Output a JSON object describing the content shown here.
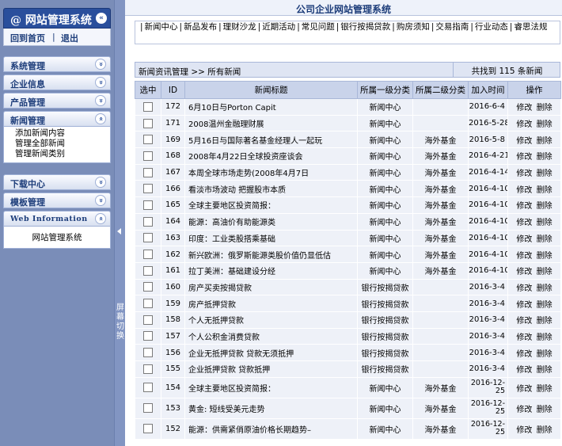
{
  "sidebar": {
    "title": "网站管理系统",
    "at_symbol": "@",
    "collapse_glyph": "«",
    "expand_glyph": "»",
    "links": {
      "home": "回到首页",
      "divider": "|",
      "logout": "退出"
    },
    "menus": [
      {
        "label": "系统管理"
      },
      {
        "label": "企业信息"
      },
      {
        "label": "产品管理"
      },
      {
        "label": "新闻管理",
        "items": [
          "添加新闻内容",
          "管理全部新闻",
          "管理新闻类别"
        ]
      },
      {
        "label": "下载中心"
      },
      {
        "label": "模板管理"
      },
      {
        "label": "Web Information",
        "items": [
          "网站管理系统"
        ]
      }
    ]
  },
  "splitter": {
    "label": "屏幕切换"
  },
  "main": {
    "title": "公司企业网站管理系统",
    "nav": [
      "新闻中心",
      "新品发布",
      "理财沙龙",
      "近期活动",
      "常见问题",
      "银行按揭贷款",
      "购房须知",
      "交易指南",
      "行业动态",
      "睿思法规"
    ],
    "nav_sep": "|",
    "breadcrumb": "新闻资讯管理 >> 所有新闻",
    "count_text": "共找到 115 条新闻",
    "table": {
      "headers": [
        "选中",
        "ID",
        "新闻标题",
        "所属一级分类",
        "所属二级分类",
        "加入时间",
        "操作"
      ],
      "edit_label": "修改",
      "delete_label": "删除",
      "rows": [
        {
          "id": "172",
          "title": "6月10日与Porton Capit",
          "cat1": "新闻中心",
          "cat2": "",
          "date": "2016-6-4"
        },
        {
          "id": "171",
          "title": "2008温州金融理财展",
          "cat1": "新闻中心",
          "cat2": "",
          "date": "2016-5-28"
        },
        {
          "id": "169",
          "title": "5月16日与国际著名基金经理人一起玩",
          "cat1": "新闻中心",
          "cat2": "海外基金",
          "date": "2016-5-8"
        },
        {
          "id": "168",
          "title": "2008年4月22日全球投资座谈会",
          "cat1": "新闻中心",
          "cat2": "海外基金",
          "date": "2016-4-21"
        },
        {
          "id": "167",
          "title": "本周全球市场走势(2008年4月7日",
          "cat1": "新闻中心",
          "cat2": "海外基金",
          "date": "2016-4-14"
        },
        {
          "id": "166",
          "title": "看淡市场波动 把握股市本质",
          "cat1": "新闻中心",
          "cat2": "海外基金",
          "date": "2016-4-10"
        },
        {
          "id": "165",
          "title": "全球主要地区投资简报：",
          "cat1": "新闻中心",
          "cat2": "海外基金",
          "date": "2016-4-10"
        },
        {
          "id": "164",
          "title": "能源：高油价有助能源类",
          "cat1": "新闻中心",
          "cat2": "海外基金",
          "date": "2016-4-10"
        },
        {
          "id": "163",
          "title": "印度：工业类股搭乘基础",
          "cat1": "新闻中心",
          "cat2": "海外基金",
          "date": "2016-4-10"
        },
        {
          "id": "162",
          "title": "新兴欧洲：俄罗斯能源类股价值仍显低估",
          "cat1": "新闻中心",
          "cat2": "海外基金",
          "date": "2016-4-10"
        },
        {
          "id": "161",
          "title": "拉丁美洲：基础建设分经",
          "cat1": "新闻中心",
          "cat2": "海外基金",
          "date": "2016-4-10"
        },
        {
          "id": "160",
          "title": "房产买卖按揭贷款",
          "cat1": "银行按揭贷款",
          "cat2": "",
          "date": "2016-3-4"
        },
        {
          "id": "159",
          "title": "房产抵押贷款",
          "cat1": "银行按揭贷款",
          "cat2": "",
          "date": "2016-3-4"
        },
        {
          "id": "158",
          "title": "个人无抵押贷款",
          "cat1": "银行按揭贷款",
          "cat2": "",
          "date": "2016-3-4"
        },
        {
          "id": "157",
          "title": "个人公积金消费贷款",
          "cat1": "银行按揭贷款",
          "cat2": "",
          "date": "2016-3-4"
        },
        {
          "id": "156",
          "title": "企业无抵押贷款 贷款无须抵押",
          "cat1": "银行按揭贷款",
          "cat2": "",
          "date": "2016-3-4"
        },
        {
          "id": "155",
          "title": "企业抵押贷款 贷款抵押",
          "cat1": "银行按揭贷款",
          "cat2": "",
          "date": "2016-3-4"
        },
        {
          "id": "154",
          "title": "全球主要地区投资简报：",
          "cat1": "新闻中心",
          "cat2": "海外基金",
          "date": "2016-12-25"
        },
        {
          "id": "153",
          "title": "黄金: 短线受美元走势",
          "cat1": "新闻中心",
          "cat2": "海外基金",
          "date": "2016-12-25"
        },
        {
          "id": "152",
          "title": "能源：供需紧俏原油价格长期趋势–",
          "cat1": "新闻中心",
          "cat2": "海外基金",
          "date": "2016-12-25"
        }
      ]
    }
  }
}
